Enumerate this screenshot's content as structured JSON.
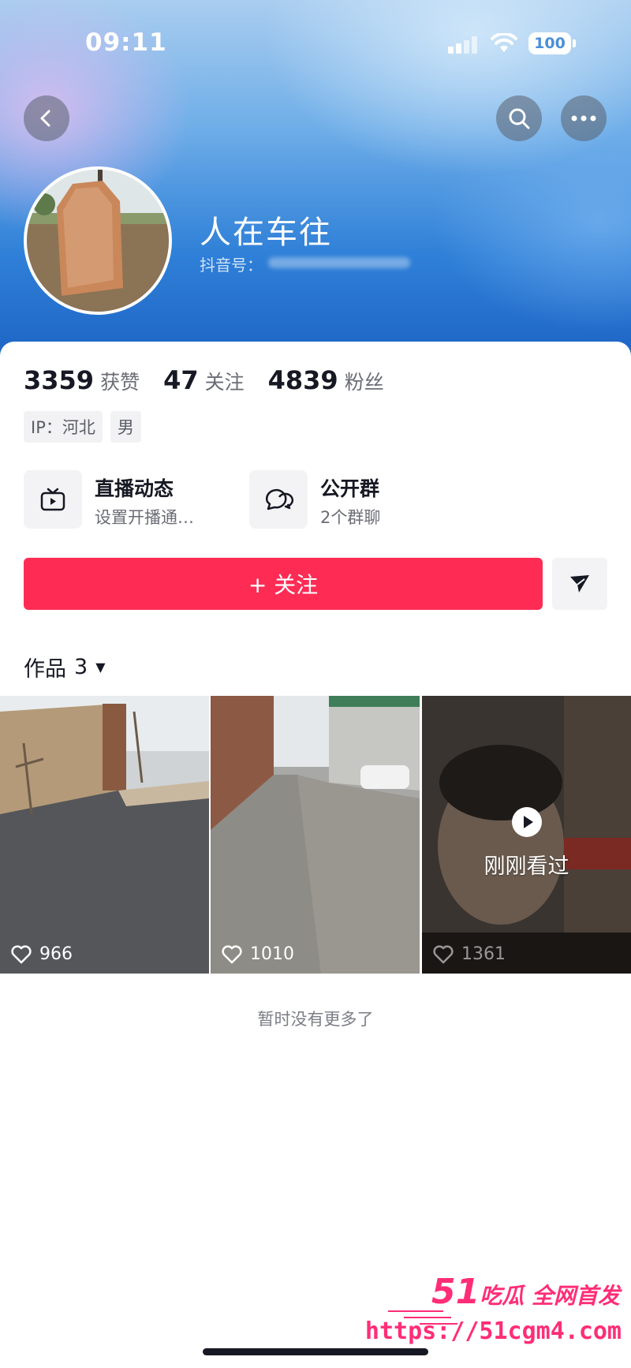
{
  "status_bar": {
    "time": "09:11",
    "battery": "100"
  },
  "profile": {
    "nickname": "人在车往",
    "douyin_id_label": "抖音号："
  },
  "stats": [
    {
      "value": "3359",
      "label": "获赞"
    },
    {
      "value": "47",
      "label": "关注"
    },
    {
      "value": "4839",
      "label": "粉丝"
    }
  ],
  "tags": [
    "IP：河北",
    "男"
  ],
  "entries": [
    {
      "title": "直播动态",
      "subtitle": "设置开播通…"
    },
    {
      "title": "公开群",
      "subtitle": "2个群聊"
    }
  ],
  "follow_label": "+ 关注",
  "works_tab": {
    "label": "作品",
    "count": "3"
  },
  "videos": [
    {
      "likes": "966"
    },
    {
      "likes": "1010"
    },
    {
      "likes": "1361",
      "badge": "刚刚看过"
    }
  ],
  "footer_text": "暂时没有更多了",
  "watermark": {
    "title_big": "51",
    "title": "吃瓜 全网首发",
    "url": "https://51cgm4.com"
  },
  "colors": {
    "accent": "#fe2c55",
    "header_blue": "#2f80d8"
  }
}
